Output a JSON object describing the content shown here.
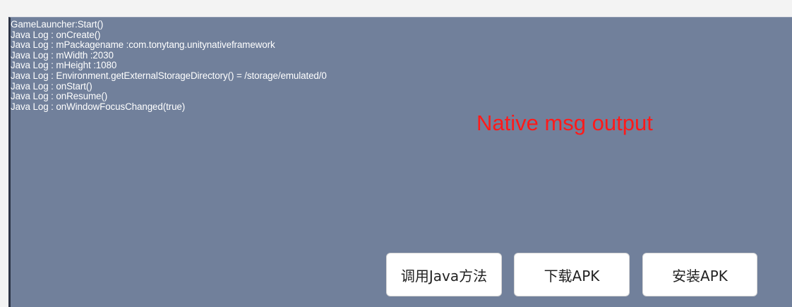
{
  "log": {
    "lines": [
      "GameLauncher:Start()",
      "Java Log : onCreate()",
      "Java Log : mPackagename :com.tonytang.unitynativeframework",
      "Java Log : mWidth :2030",
      "Java Log : mHeight :1080",
      "Java Log : Environment.getExternalStorageDirectory() = /storage/emulated/0",
      "Java Log : onStart()",
      "Java Log : onResume()",
      "Java Log : onWindowFocusChanged(true)"
    ]
  },
  "native_msg": "Native msg output",
  "buttons": {
    "call_java": "调用Java方法",
    "download_apk": "下载APK",
    "install_apk": "安装APK"
  },
  "colors": {
    "background": "#71809b",
    "log_text": "#ffffff",
    "native_msg_text": "#ff1a1a",
    "button_bg": "#ffffff"
  }
}
